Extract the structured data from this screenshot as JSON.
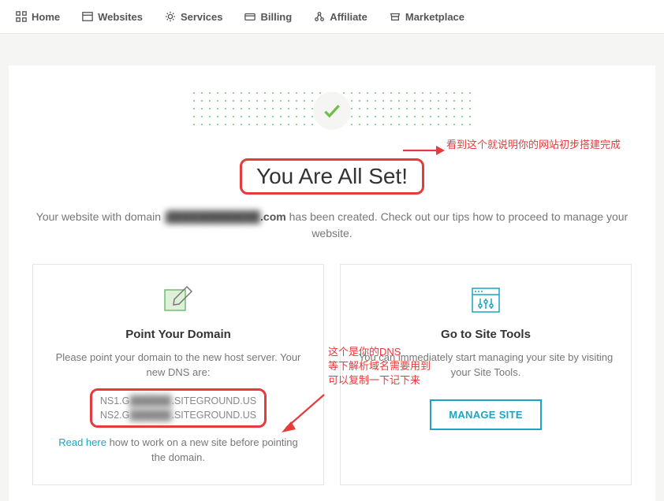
{
  "nav": {
    "home": "Home",
    "websites": "Websites",
    "services": "Services",
    "billing": "Billing",
    "affiliate": "Affiliate",
    "marketplace": "Marketplace"
  },
  "hero": {
    "title": "You Are All Set!",
    "sub_pre": "Your website with domain ",
    "domain_blur": "j████████████",
    "sub_mid": ".com",
    "sub_post": " has been created. Check out our tips how to proceed to manage your website."
  },
  "card_left": {
    "title": "Point Your Domain",
    "text": "Please point your domain to the new host server. Your new DNS are:",
    "dns1_pre": "NS1.G",
    "dns1_blur": "██████",
    "dns1_post": ".SITEGROUND.US",
    "dns2_pre": "NS2.G",
    "dns2_blur": "██████",
    "dns2_post": ".SITEGROUND.US",
    "read_here": "Read here",
    "read_tail": " how to work on a new site before pointing the domain."
  },
  "card_right": {
    "title": "Go to Site Tools",
    "text": "You can immediately start managing your site by visiting your Site Tools.",
    "button": "MANAGE SITE"
  },
  "annotations": {
    "a1": "看到这个就说明你的网站初步搭建完成",
    "a2_l1": "这个是你的DNS",
    "a2_l2": "等下解析域名需要用到",
    "a2_l3": "可以复制一下记下来"
  }
}
